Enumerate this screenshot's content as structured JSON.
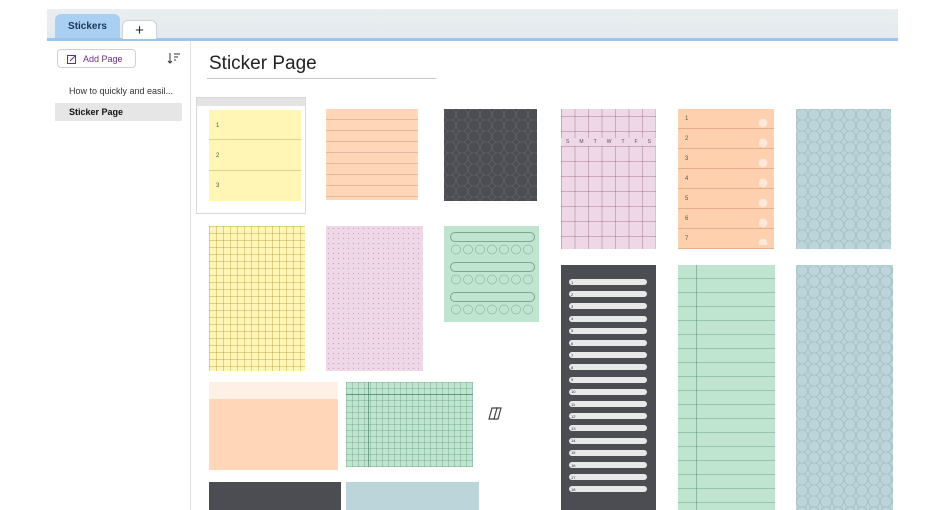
{
  "tabs": {
    "active_label": "Stickers",
    "add_label": "+"
  },
  "sidebar": {
    "add_page_label": "Add Page",
    "pages": [
      {
        "label": "How to quickly and easil...",
        "selected": false
      },
      {
        "label": "Sticker Page",
        "selected": true
      }
    ]
  },
  "page": {
    "title": "Sticker Page"
  },
  "stickers": {
    "numbered_yellow": [
      "1",
      "2",
      "3"
    ],
    "calendar_days": [
      "S",
      "M",
      "T",
      "W",
      "T",
      "F",
      "S"
    ],
    "orange_list": [
      "1",
      "2",
      "3",
      "4",
      "5",
      "6",
      "7"
    ],
    "dark_list": [
      "1",
      "2",
      "3",
      "4",
      "5",
      "6",
      "7",
      "8",
      "9",
      "10",
      "11",
      "12",
      "13",
      "14",
      "15",
      "16",
      "17",
      "18"
    ]
  },
  "colors": {
    "accent": "#9cc4ec",
    "tab_active": "#a9cff3",
    "yellow": "#fff5b5",
    "peach": "#ffd6b8",
    "dark": "#4b4d52",
    "pink": "#eed7e6",
    "mint": "#bfe4cf",
    "blue_gray": "#bcd5da"
  }
}
